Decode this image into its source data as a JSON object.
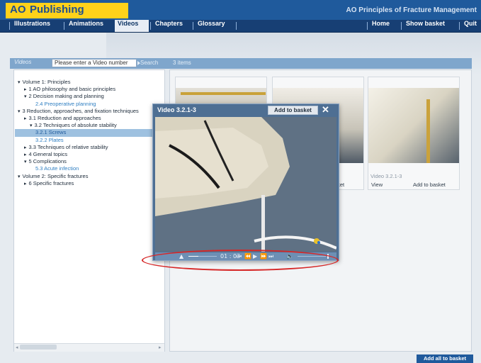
{
  "header": {
    "logo_ao": "AO",
    "logo_publishing": "Publishing",
    "app_title": "AO Principles of Fracture Management"
  },
  "nav": {
    "illustrations": "Illustrations",
    "animations": "Animations",
    "videos": "Videos",
    "chapters": "Chapters",
    "glossary": "Glossary",
    "home": "Home",
    "show_basket": "Show basket",
    "quit": "Quit"
  },
  "toolbar": {
    "label": "Videos",
    "search_placeholder": "Please enter a Video number",
    "search_button": "Search",
    "items_count": "3 items"
  },
  "tree": [
    {
      "label": "Volume 1: Principles",
      "toggle": "▾"
    },
    {
      "label": "1 AO philosophy and basic principles",
      "toggle": "▸"
    },
    {
      "label": "2 Decision making and planning",
      "toggle": "▾"
    },
    {
      "label": "2.4 Preoperative planning",
      "toggle": ""
    },
    {
      "label": "3 Reduction, approaches, and fixation techniques",
      "toggle": "▾"
    },
    {
      "label": "3.1 Reduction and approaches",
      "toggle": "▸"
    },
    {
      "label": "3.2 Techniques of absolute stability",
      "toggle": "▾"
    },
    {
      "label": "3.2.1 Screws",
      "toggle": ""
    },
    {
      "label": "3.2.2 Plates",
      "toggle": ""
    },
    {
      "label": "3.3 Techniques of relative stability",
      "toggle": "▸"
    },
    {
      "label": "4 General topics",
      "toggle": "▸"
    },
    {
      "label": "5 Complications",
      "toggle": "▾"
    },
    {
      "label": "5.3 Acute infection",
      "toggle": ""
    },
    {
      "label": "Volume 2: Specific fractures",
      "toggle": "▾"
    },
    {
      "label": "6 Specific fractures",
      "toggle": "▸"
    }
  ],
  "cards": [
    {
      "caption": "",
      "view": "",
      "add": ""
    },
    {
      "caption": "",
      "view": "",
      "add": "basket"
    },
    {
      "caption": "Video 3.2.1-3",
      "view": "View",
      "add": "Add to basket"
    }
  ],
  "player": {
    "title": "Video 3.2.1-3",
    "add_to_basket": "Add to basket",
    "close": "✕",
    "time": "01 : 03",
    "progress": 0.35
  },
  "add_all": "Add all to basket",
  "icons": {
    "close": "close-icon",
    "eject": "eject-icon",
    "skip_start": "skip-to-start-icon",
    "rewind": "rewind-icon",
    "play": "play-icon",
    "fast_forward": "fast-forward-icon",
    "skip_end": "skip-to-end-icon",
    "volume": "volume-icon"
  },
  "colors": {
    "header": "#1f5a9c",
    "logo": "#ffd21a",
    "link": "#2f7fc2",
    "annotation": "#d62828"
  }
}
